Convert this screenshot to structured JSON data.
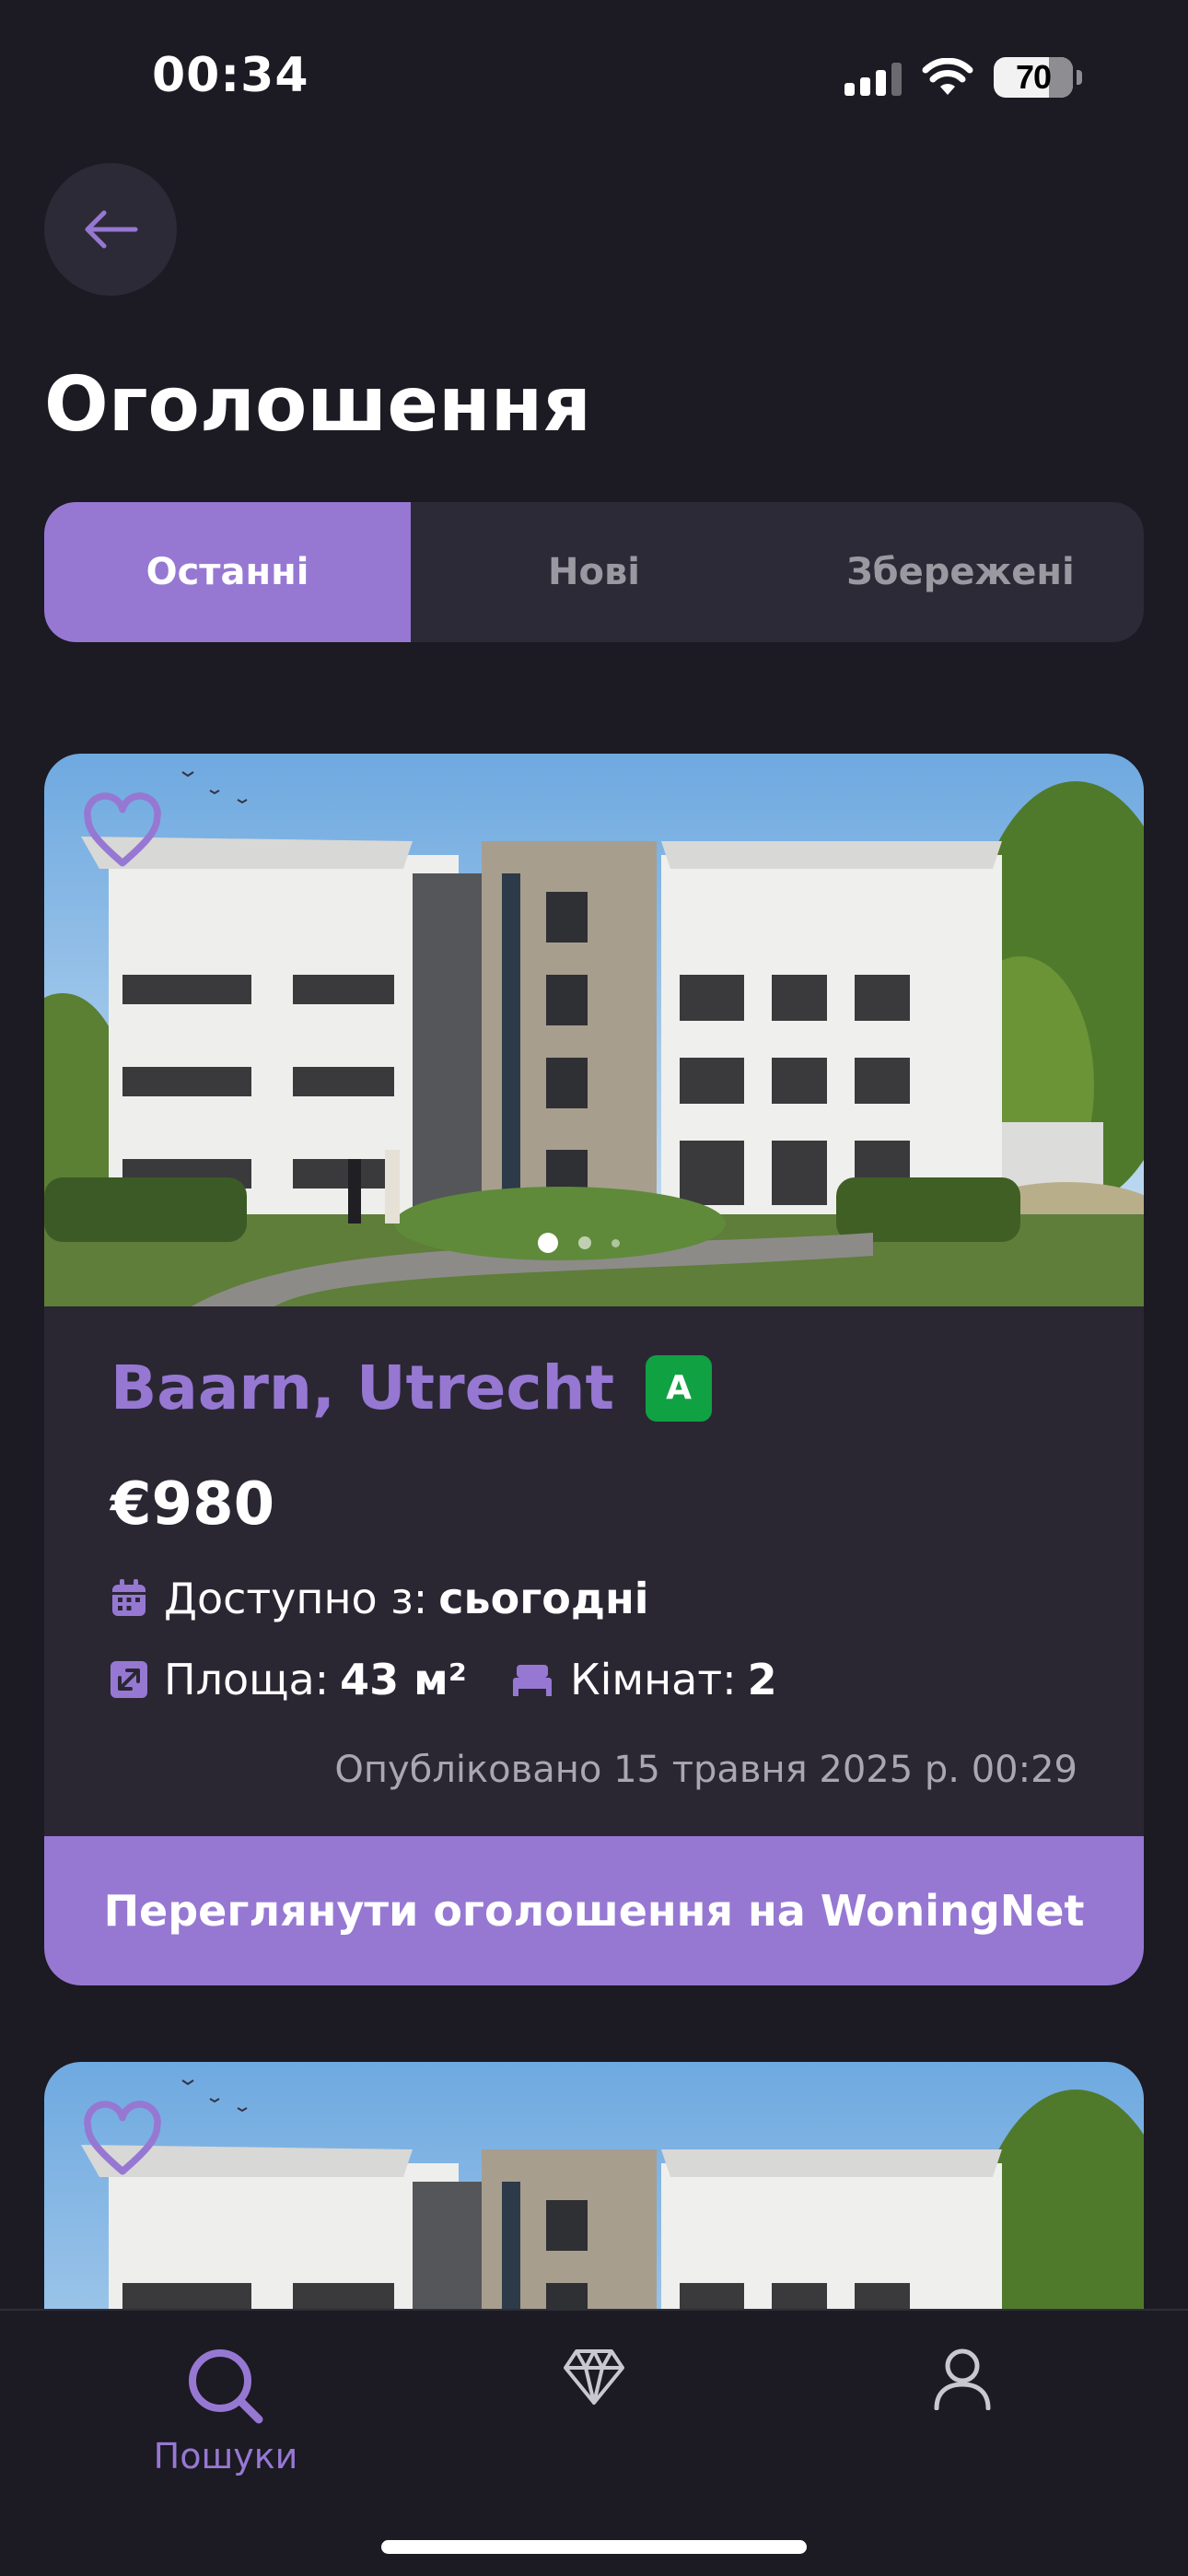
{
  "status_bar": {
    "time": "00:34",
    "battery": "70"
  },
  "header": {
    "title": "Оголошення"
  },
  "tabs": [
    {
      "label": "Останні",
      "active": true
    },
    {
      "label": "Нові",
      "active": false
    },
    {
      "label": "Збережені",
      "active": false
    }
  ],
  "listings": [
    {
      "location": "Baarn, Utrecht",
      "energy_label": "A",
      "price": "€980",
      "available_label": "Доступно з:",
      "available_value": "сьогодні",
      "area_label": "Площа:",
      "area_value": "43 м²",
      "rooms_label": "Кімнат:",
      "rooms_value": "2",
      "published": "Опубліковано 15 травня 2025 р. 00:29",
      "cta": "Переглянути оголошення на WoningNet",
      "image_dots": 3,
      "active_dot": 0
    }
  ],
  "bottom_nav": [
    {
      "label": "Пошуки",
      "icon": "search-icon",
      "active": true
    },
    {
      "label": "",
      "icon": "diamond-icon",
      "active": false
    },
    {
      "label": "",
      "icon": "profile-icon",
      "active": false
    }
  ],
  "colors": {
    "background": "#1c1a22",
    "accent": "#9678d3",
    "card": "#2a2733",
    "energy_badge": "#10a143"
  }
}
